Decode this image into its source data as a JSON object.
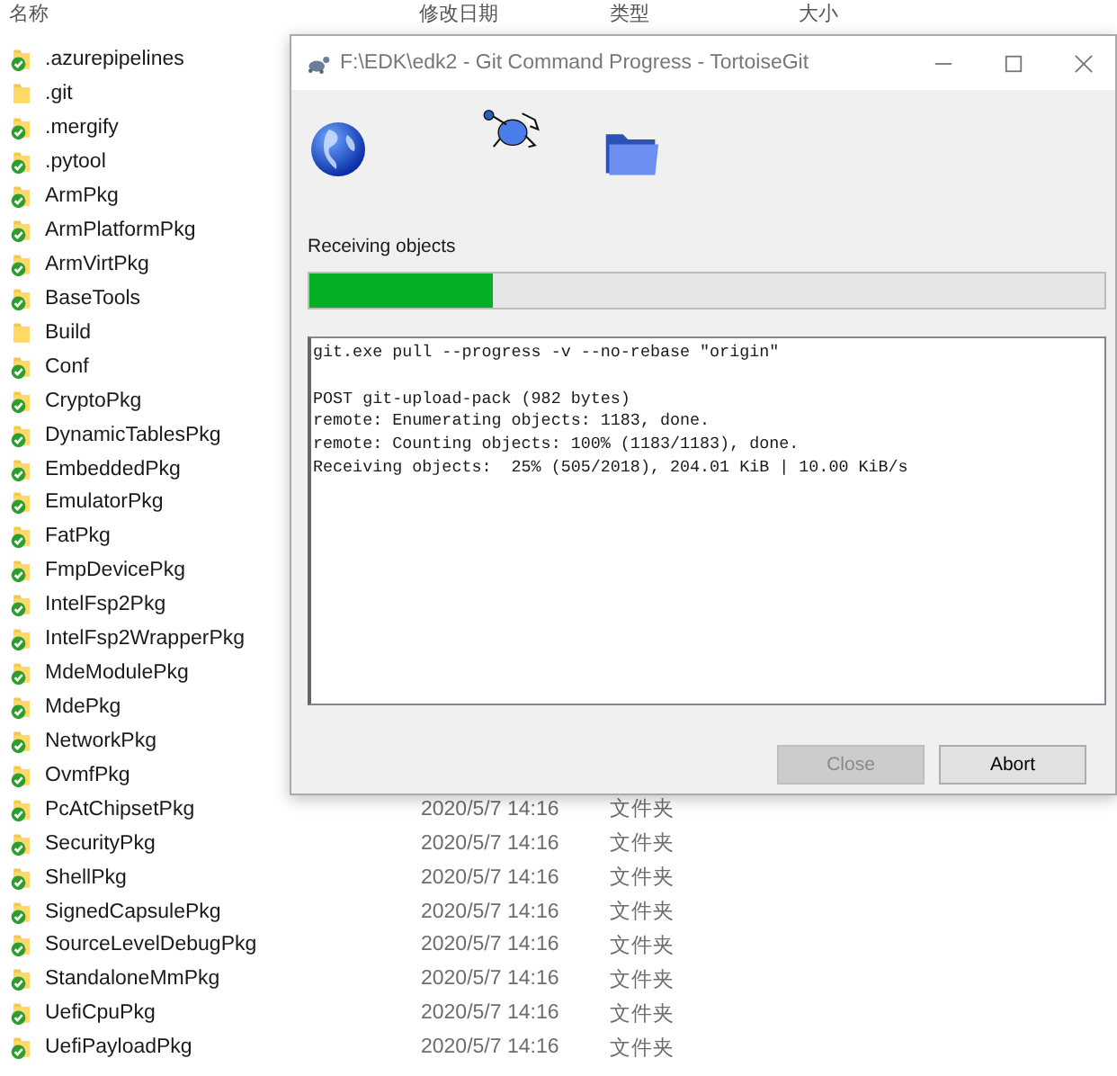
{
  "explorer": {
    "columns": [
      "名称",
      "修改日期",
      "类型",
      "大小"
    ],
    "rows": [
      {
        "name": ".azurepipelines",
        "kind": "versioned"
      },
      {
        "name": ".git",
        "kind": "plain"
      },
      {
        "name": ".mergify",
        "kind": "versioned"
      },
      {
        "name": ".pytool",
        "kind": "versioned"
      },
      {
        "name": "ArmPkg",
        "kind": "versioned"
      },
      {
        "name": "ArmPlatformPkg",
        "kind": "versioned"
      },
      {
        "name": "ArmVirtPkg",
        "kind": "versioned"
      },
      {
        "name": "BaseTools",
        "kind": "versioned"
      },
      {
        "name": "Build",
        "kind": "plain"
      },
      {
        "name": "Conf",
        "kind": "versioned"
      },
      {
        "name": "CryptoPkg",
        "kind": "versioned"
      },
      {
        "name": "DynamicTablesPkg",
        "kind": "versioned"
      },
      {
        "name": "EmbeddedPkg",
        "kind": "versioned"
      },
      {
        "name": "EmulatorPkg",
        "kind": "versioned"
      },
      {
        "name": "FatPkg",
        "kind": "versioned"
      },
      {
        "name": "FmpDevicePkg",
        "kind": "versioned"
      },
      {
        "name": "IntelFsp2Pkg",
        "kind": "versioned"
      },
      {
        "name": "IntelFsp2WrapperPkg",
        "kind": "versioned"
      },
      {
        "name": "MdeModulePkg",
        "kind": "versioned"
      },
      {
        "name": "MdePkg",
        "kind": "versioned"
      },
      {
        "name": "NetworkPkg",
        "kind": "versioned"
      },
      {
        "name": "OvmfPkg",
        "kind": "versioned"
      },
      {
        "name": "PcAtChipsetPkg",
        "kind": "versioned",
        "date": "2020/5/7 14:16",
        "type": "文件夹"
      },
      {
        "name": "SecurityPkg",
        "kind": "versioned",
        "date": "2020/5/7 14:16",
        "type": "文件夹"
      },
      {
        "name": "ShellPkg",
        "kind": "versioned",
        "date": "2020/5/7 14:16",
        "type": "文件夹"
      },
      {
        "name": "SignedCapsulePkg",
        "kind": "versioned",
        "date": "2020/5/7 14:16",
        "type": "文件夹"
      },
      {
        "name": "SourceLevelDebugPkg",
        "kind": "versioned",
        "date": "2020/5/7 14:16",
        "type": "文件夹"
      },
      {
        "name": "StandaloneMmPkg",
        "kind": "versioned",
        "date": "2020/5/7 14:16",
        "type": "文件夹"
      },
      {
        "name": "UefiCpuPkg",
        "kind": "versioned",
        "date": "2020/5/7 14:16",
        "type": "文件夹"
      },
      {
        "name": "UefiPayloadPkg",
        "kind": "versioned",
        "date": "2020/5/7 14:16",
        "type": "文件夹"
      }
    ]
  },
  "dialog": {
    "title": "F:\\EDK\\edk2 - Git Command Progress - TortoiseGit",
    "status": "Receiving objects",
    "progress": {
      "level": 0.23
    },
    "log": [
      {
        "kind": "command",
        "text": "git.exe pull --progress -v --no-rebase \"origin\""
      },
      {
        "kind": "output",
        "text": "POST git-upload-pack (982 bytes)"
      },
      {
        "kind": "output",
        "text": "remote: Enumerating objects: 1183, done."
      },
      {
        "kind": "output",
        "text": "remote: Counting objects: 100% (1183/1183), done."
      },
      {
        "kind": "output",
        "text": "Receiving objects:  25% (505/2018), 204.01 KiB | 10.00 KiB/s"
      }
    ],
    "buttons": [
      {
        "label": "Close",
        "disabled": true
      },
      {
        "label": "Abort",
        "disabled": false
      }
    ]
  }
}
